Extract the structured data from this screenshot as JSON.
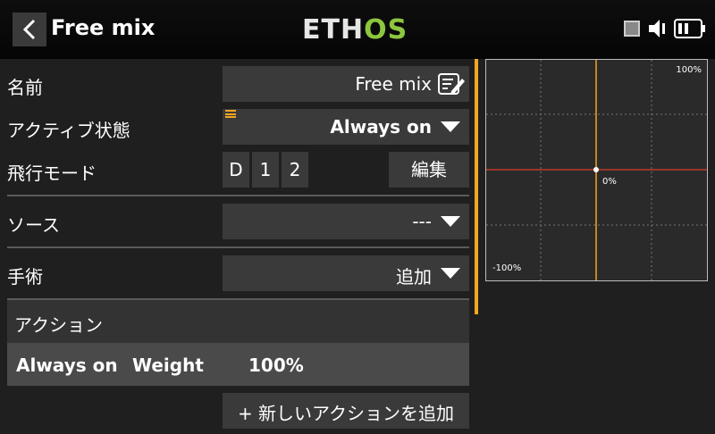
{
  "header": {
    "title": "Free mix",
    "logo": {
      "part1": "ETH",
      "part2": "OS"
    }
  },
  "fields": {
    "name": {
      "label": "名前",
      "value": "Free mix"
    },
    "active": {
      "label": "アクティブ状態",
      "value": "Always on"
    },
    "flight_mode": {
      "label": "飛行モード",
      "modes": [
        "D",
        "1",
        "2"
      ],
      "edit_label": "編集"
    },
    "source": {
      "label": "ソース",
      "value": "---"
    },
    "operation": {
      "label": "手術",
      "value": "追加"
    }
  },
  "actions": {
    "title": "アクション",
    "rows": [
      {
        "condition": "Always on",
        "type": "Weight",
        "value": "100%"
      }
    ],
    "add_label": "+ 新しいアクションを追加"
  },
  "curve": {
    "top_label": "100%",
    "center_label": "0%",
    "bottom_label": "-100%"
  },
  "colors": {
    "accent": "#f5a623",
    "logo_green": "#8cc63f",
    "curve_line": "#c0392b"
  }
}
